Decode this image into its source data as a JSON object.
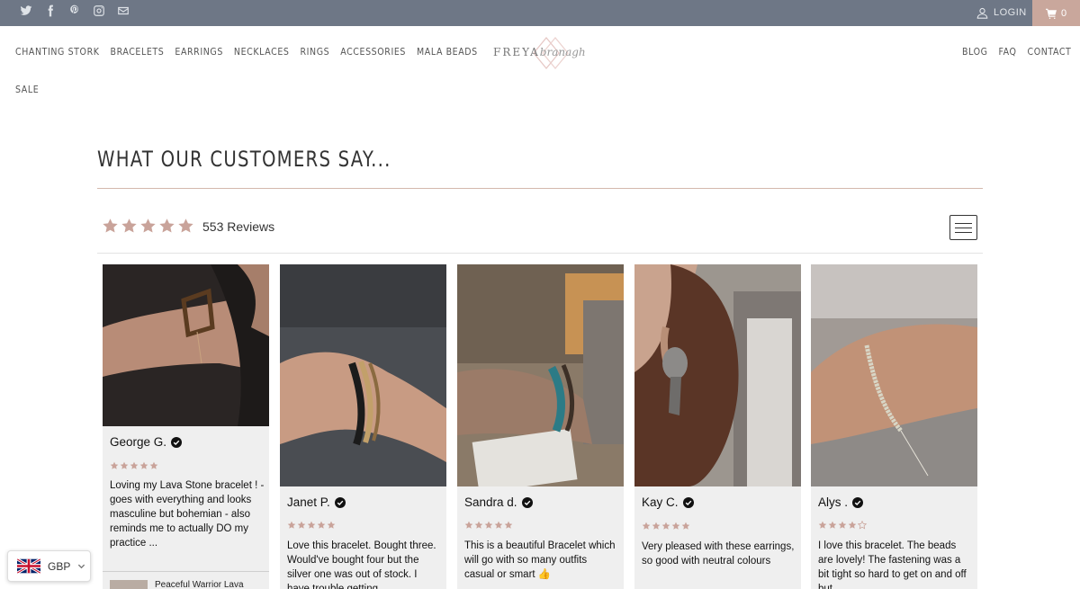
{
  "header": {
    "social_icons": [
      "twitter-icon",
      "facebook-icon",
      "pinterest-icon",
      "instagram-icon",
      "mail-icon"
    ],
    "login_label": "LOGIN",
    "cart_count": "0",
    "colors": {
      "topbar": "#6e7786",
      "cart_bg": "#c9a79c",
      "accent": "#c9a39a"
    }
  },
  "nav": {
    "left": [
      "CHANTING STORK",
      "BRACELETS",
      "EARRINGS",
      "NECKLACES",
      "RINGS",
      "ACCESSORIES",
      "MALA BEADS"
    ],
    "sale": "SALE",
    "right": [
      "BLOG",
      "FAQ",
      "CONTACT"
    ]
  },
  "logo": {
    "word1": "FREYA",
    "word2": "branagh"
  },
  "page": {
    "title": "WHAT OUR CUSTOMERS SAY..."
  },
  "summary": {
    "rating": 5,
    "count_label": "553 Reviews"
  },
  "reviews": [
    {
      "name": "George G.",
      "rating": 5,
      "text": "Loving my Lava Stone bracelet ! - goes with everything and looks masculine but bohemian - also reminds me to actually DO my practice ...",
      "product": "Peaceful Warrior Lava"
    },
    {
      "name": "Janet P.",
      "rating": 5,
      "text": "Love this bracelet. Bought three. Would've bought four but the silver one was out of stock. I have trouble getting"
    },
    {
      "name": "Sandra d.",
      "rating": 5,
      "text": "This is a beautiful Bracelet which will go with so many outfits casual or smart 👍"
    },
    {
      "name": "Kay C.",
      "rating": 5,
      "text": "Very pleased with these earrings, so good with neutral colours"
    },
    {
      "name": "Alys .",
      "rating": 4,
      "text": "I love this bracelet. The beads are lovely! The fastening was a bit tight so hard to get on and off but"
    }
  ],
  "currency": {
    "code": "GBP",
    "flag": "uk-flag-icon"
  }
}
